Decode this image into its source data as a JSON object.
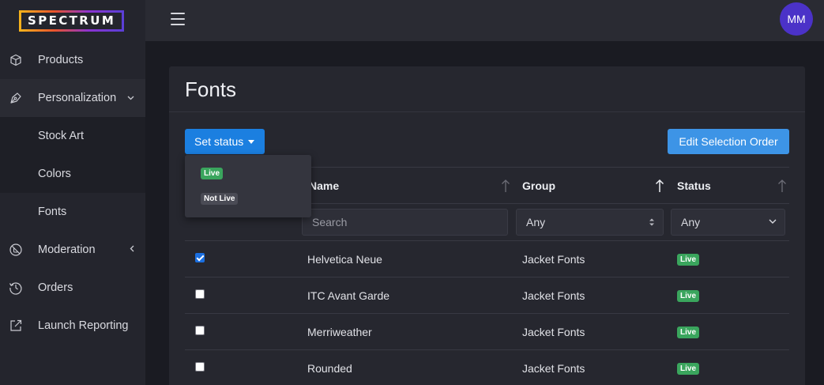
{
  "app": {
    "logo_text": "SPECTRUM",
    "user_initials": "MM"
  },
  "sidebar": {
    "items": [
      {
        "label": "Products",
        "icon": "cube-icon"
      },
      {
        "label": "Personalization",
        "icon": "pen-nib-icon",
        "expanded": true
      },
      {
        "label": "Stock Art"
      },
      {
        "label": "Colors"
      },
      {
        "label": "Fonts",
        "active": true
      },
      {
        "label": "Moderation",
        "icon": "ban-icon",
        "expanded": false
      },
      {
        "label": "Orders",
        "icon": "history-icon"
      },
      {
        "label": "Launch Reporting",
        "icon": "external-link-icon"
      }
    ]
  },
  "page": {
    "title": "Fonts"
  },
  "toolbar": {
    "set_status_label": "Set status",
    "edit_order_label": "Edit Selection Order"
  },
  "status_menu": {
    "options": [
      "Live",
      "Not Live"
    ]
  },
  "table": {
    "columns": [
      "Name",
      "Group",
      "Status"
    ],
    "filters": {
      "search_placeholder": "Search",
      "group_value": "Any",
      "status_value": "Any"
    },
    "rows": [
      {
        "checked": true,
        "name": "Helvetica Neue",
        "group": "Jacket Fonts",
        "status": "Live"
      },
      {
        "checked": false,
        "name": "ITC Avant Garde",
        "group": "Jacket Fonts",
        "status": "Live"
      },
      {
        "checked": false,
        "name": "Merriweather",
        "group": "Jacket Fonts",
        "status": "Live"
      },
      {
        "checked": false,
        "name": "Rounded",
        "group": "Jacket Fonts",
        "status": "Live"
      }
    ]
  },
  "colors": {
    "primary": "#1b7fe0",
    "live": "#3aa55d",
    "not_live": "#4a4b55",
    "avatar": "#4b32c8"
  }
}
